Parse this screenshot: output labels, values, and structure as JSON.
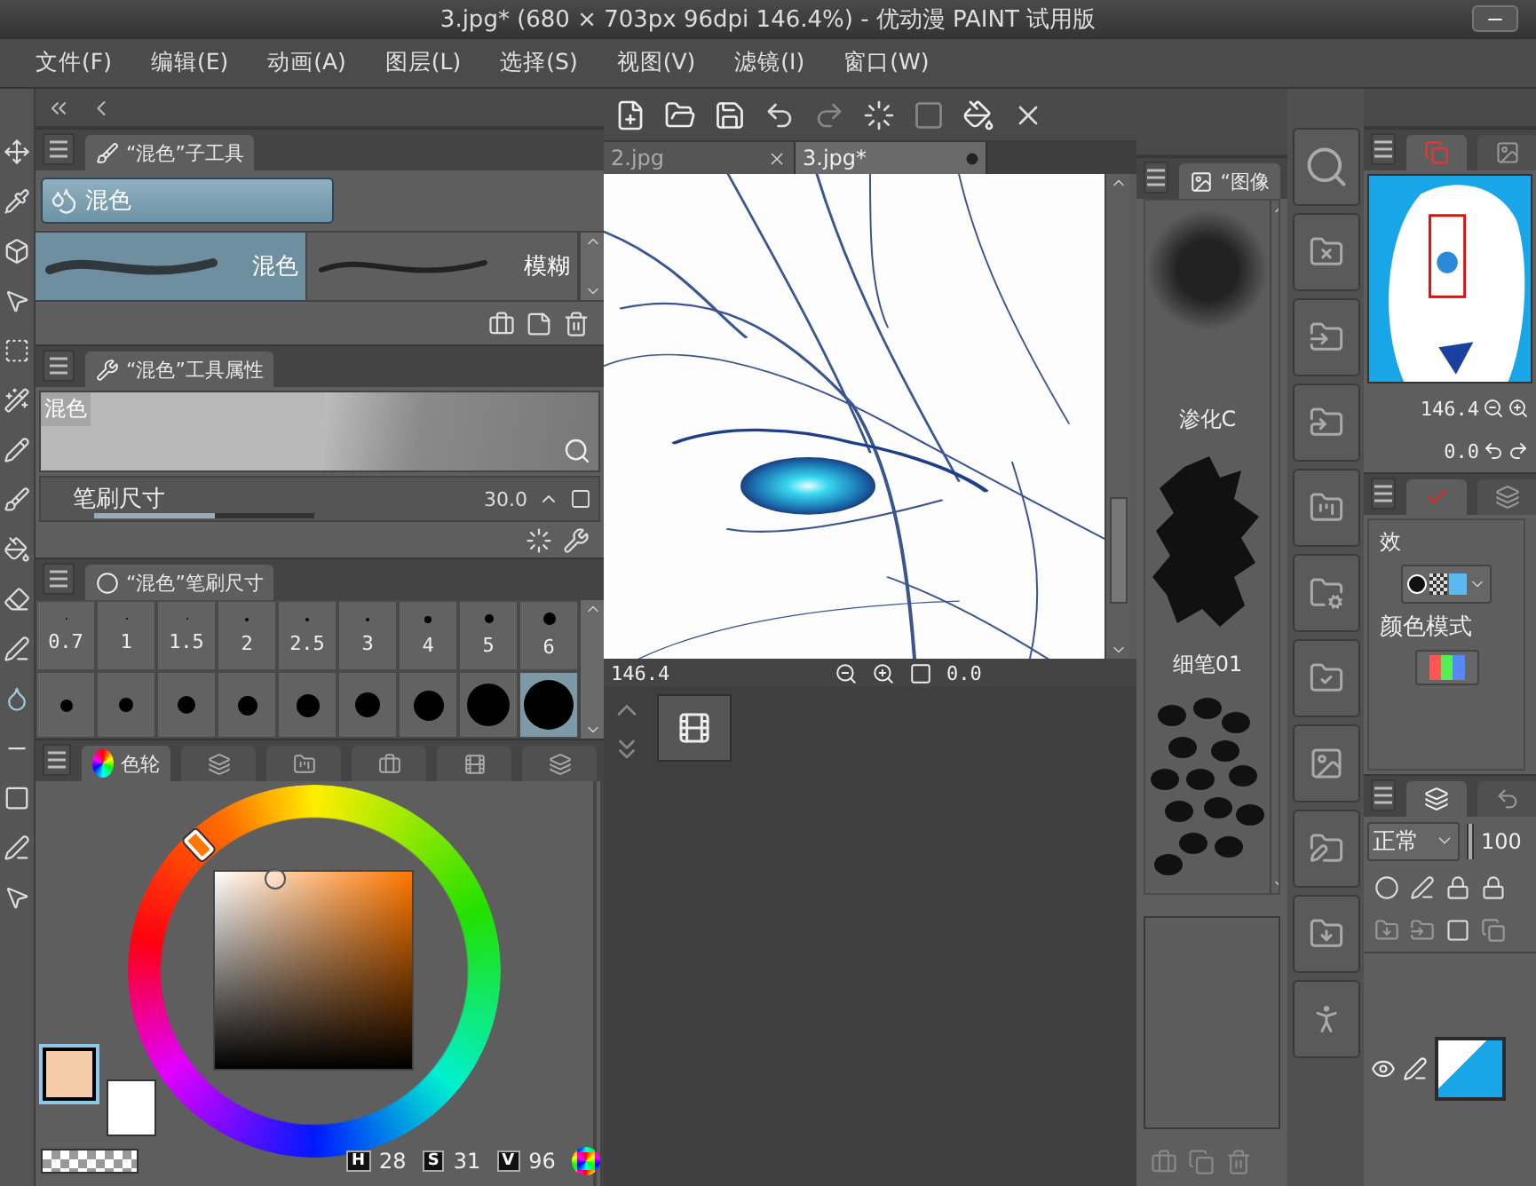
{
  "window": {
    "title": "3.jpg* (680 × 703px 96dpi 146.4%)  - 优动漫 PAINT 试用版"
  },
  "menu": [
    "文件(F)",
    "编辑(E)",
    "动画(A)",
    "图层(L)",
    "选择(S)",
    "视图(V)",
    "滤镜(I)",
    "窗口(W)"
  ],
  "subtool_panel": {
    "tab": "“混色”子工具",
    "groups": [
      {
        "label": "混色",
        "selected": true
      }
    ],
    "brushes": [
      {
        "label": "混色",
        "selected": true
      },
      {
        "label": "模糊",
        "selected": false
      }
    ]
  },
  "tool_property": {
    "tab": "“混色”工具属性",
    "preview_label": "混色",
    "rows": [
      {
        "label": "笔刷尺寸",
        "value": "30.0",
        "level": 0.55
      }
    ]
  },
  "brush_size": {
    "tab": "“混色”笔刷尺寸",
    "sizes": [
      {
        "label": "0.7",
        "selected": false
      },
      {
        "label": "1",
        "selected": false
      },
      {
        "label": "1.5",
        "selected": false
      },
      {
        "label": "2",
        "selected": false
      },
      {
        "label": "2.5",
        "selected": false
      },
      {
        "label": "3",
        "selected": false
      },
      {
        "label": "4",
        "selected": false
      },
      {
        "label": "5",
        "selected": false
      },
      {
        "label": "6",
        "selected": false
      }
    ],
    "large_sizes": [
      {
        "selected": false
      },
      {
        "selected": false
      },
      {
        "selected": false
      },
      {
        "selected": false
      },
      {
        "selected": false
      },
      {
        "selected": false
      },
      {
        "selected": false
      },
      {
        "selected": false
      },
      {
        "selected": true
      }
    ]
  },
  "color_panel": {
    "tabs": [
      {
        "label": "色轮",
        "selected": true
      },
      {
        "selected": false
      },
      {
        "selected": false
      },
      {
        "selected": false
      },
      {
        "selected": false
      },
      {
        "selected": false
      }
    ],
    "readouts": [
      {
        "label": "H",
        "value": "28"
      },
      {
        "label": "S",
        "value": "31"
      },
      {
        "label": "V",
        "value": "96"
      }
    ]
  },
  "document_tabs": [
    {
      "label": "2.jpg",
      "selected": false
    },
    {
      "label": "3.jpg*",
      "selected": true
    }
  ],
  "canvas_status": {
    "zoom": "146.4",
    "angle": "0.0"
  },
  "materials": {
    "tab": "“图像",
    "items": [
      {
        "kind": "blot",
        "label": "渗化C"
      },
      {
        "kind": "splash",
        "label": "细笔01"
      },
      {
        "kind": "spots"
      }
    ]
  },
  "navigator": {
    "tabs": [
      {
        "selected": true
      },
      {
        "selected": false
      }
    ],
    "zoom": "146.4",
    "angle": "0.0"
  },
  "layer_property": {
    "tabs": [
      {
        "selected": true
      },
      {
        "selected": false
      }
    ],
    "effect_label": "效",
    "color_mode_label": "颜色模式"
  },
  "layers": {
    "tabs": [
      {
        "selected": true
      },
      {
        "selected": false
      }
    ],
    "blend_mode": "正常",
    "opacity": "100"
  }
}
